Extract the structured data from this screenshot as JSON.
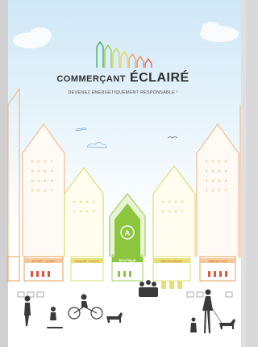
{
  "brand": {
    "title_part1": "COMMERÇANT",
    "title_part2": "ÉCLAIRÉ",
    "tagline": "DEVENEZ ÉNERGÉTIQUEMENT RESPONSABLE !"
  },
  "storefronts": [
    {
      "label": "SPORT · ADDO"
    },
    {
      "label": "SNACK · ACCO"
    },
    {
      "label": "BOUTIQUE"
    },
    {
      "label": "RESTAURANT"
    },
    {
      "label": "MÉDAILLES"
    }
  ],
  "energy_label": {
    "letter": "A"
  },
  "colors": {
    "accent_green": "#8cc63f",
    "accent_orange": "#f0a04b",
    "accent_yellow": "#d8d454",
    "accent_red": "#e2553b",
    "text_dark": "#2e2e2e"
  }
}
